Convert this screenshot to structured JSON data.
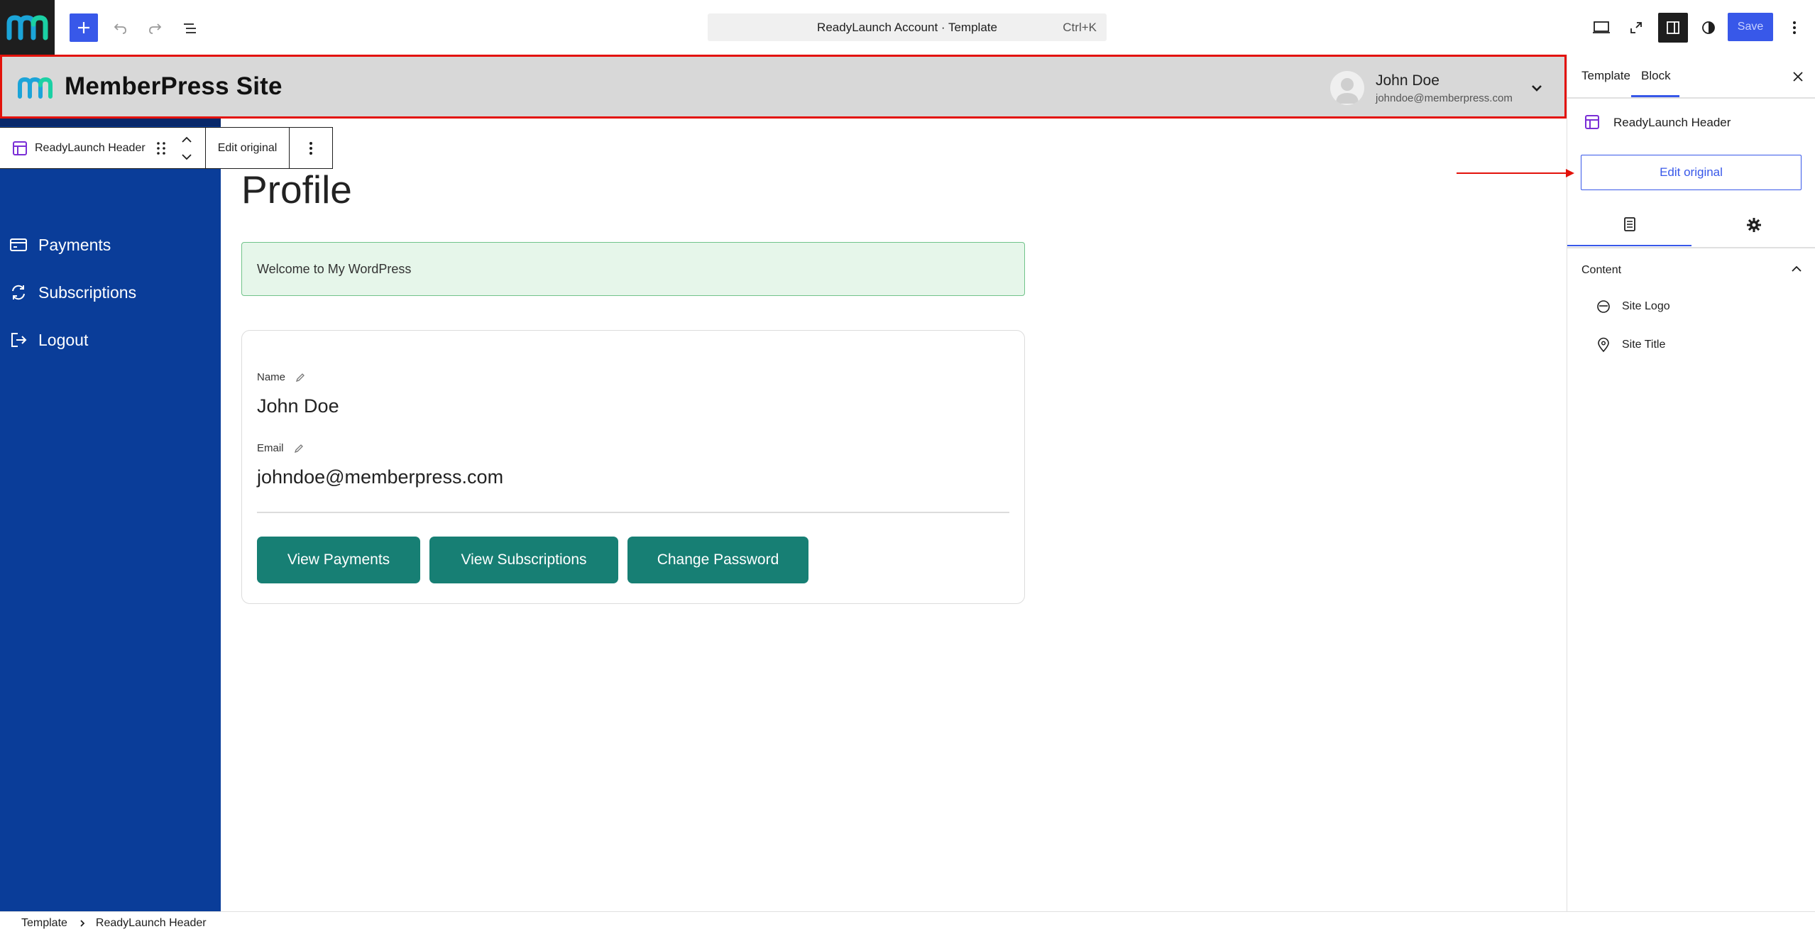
{
  "toolbar": {
    "command_title": "ReadyLaunch Account · Template",
    "command_shortcut": "Ctrl+K",
    "save_label": "Save"
  },
  "site_header": {
    "title": "MemberPress Site",
    "user_name": "John Doe",
    "user_email": "johndoe@memberpress.com"
  },
  "block_toolbar": {
    "block_type": "ReadyLaunch Header",
    "edit_label": "Edit original"
  },
  "nav": {
    "items": [
      {
        "label": "Payments",
        "icon": "credit-card-icon"
      },
      {
        "label": "Subscriptions",
        "icon": "sync-icon"
      },
      {
        "label": "Logout",
        "icon": "logout-icon"
      }
    ]
  },
  "page": {
    "title": "Profile",
    "welcome": "Welcome to My WordPress",
    "name_label": "Name",
    "name_value": "John Doe",
    "email_label": "Email",
    "email_value": "johndoe@memberpress.com",
    "buttons": [
      "View Payments",
      "View Subscriptions",
      "Change Password"
    ]
  },
  "settings_panel": {
    "tabs": [
      "Template",
      "Block"
    ],
    "active_tab": "Block",
    "block_name": "ReadyLaunch Header",
    "edit_original": "Edit original",
    "section_title": "Content",
    "items": [
      {
        "label": "Site Logo",
        "icon": "site-logo-icon"
      },
      {
        "label": "Site Title",
        "icon": "map-marker-icon"
      }
    ]
  },
  "breadcrumb": [
    "Template",
    "ReadyLaunch Header"
  ],
  "colors": {
    "accent": "#3858e9",
    "sidebar": "#0a3d99",
    "button": "#177f74",
    "highlight": "#e3120b"
  }
}
